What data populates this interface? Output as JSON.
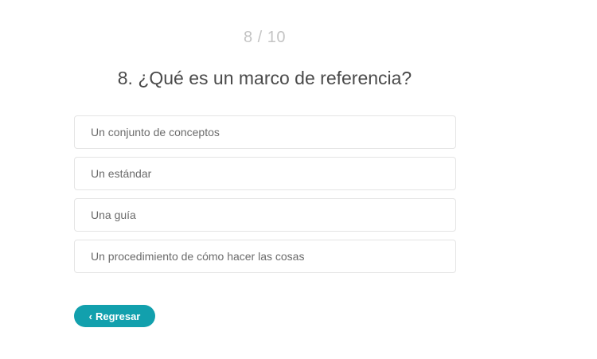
{
  "quiz": {
    "progress": "8 / 10",
    "question": "8. ¿Qué es un marco de referencia?",
    "options": [
      {
        "label": "Un conjunto de conceptos"
      },
      {
        "label": "Un estándar"
      },
      {
        "label": "Una guía"
      },
      {
        "label": "Un procedimiento de cómo hacer las cosas"
      }
    ],
    "back_icon": "chevron-left-icon",
    "back_label": "Regresar"
  },
  "colors": {
    "accent": "#12a0ad",
    "progress_text": "#c4c4c4",
    "question_text": "#4a4a4a",
    "option_border": "#e4e4e4"
  }
}
